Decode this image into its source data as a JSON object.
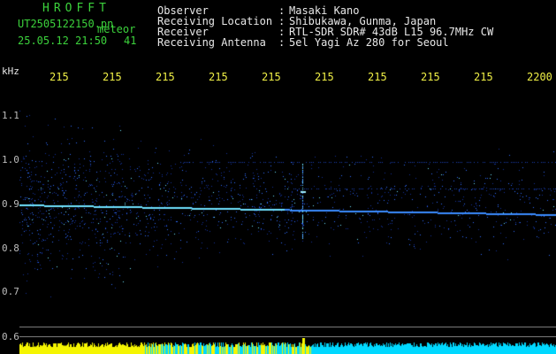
{
  "header": {
    "app_title": "HROFFT",
    "file_name": "UT2505122150.pn",
    "mode": "meteor",
    "date_time": "25.05.12 21:50",
    "peak_value": "41"
  },
  "station_info": [
    {
      "label": "Observer",
      "value": "Masaki Kano"
    },
    {
      "label": "Receiving Location",
      "value": "Shibukawa, Gunma, Japan"
    },
    {
      "label": "Receiver",
      "value": "RTL-SDR SDR# 43dB L15 96.7MHz CW"
    },
    {
      "label": "Receiving Antenna",
      "value": "5el Yagi Az 280 for Seoul"
    }
  ],
  "axes": {
    "unit": "kHz",
    "time_ticks": [
      "215",
      "215",
      "215",
      "215",
      "215",
      "215",
      "215",
      "215",
      "215",
      "2200"
    ],
    "freq_ticks": [
      "1.1",
      "1.0",
      "0.9",
      "0.8",
      "0.7",
      "0.6"
    ]
  },
  "colors": {
    "background": "#000000",
    "header_green": "#3cd23c",
    "tick_yellow": "#f0f046",
    "signal_blue": "#2f6bff",
    "signal_cyan": "#6fe3ff",
    "level_yellow": "#f5f500",
    "level_cyan": "#00d8ff"
  }
}
